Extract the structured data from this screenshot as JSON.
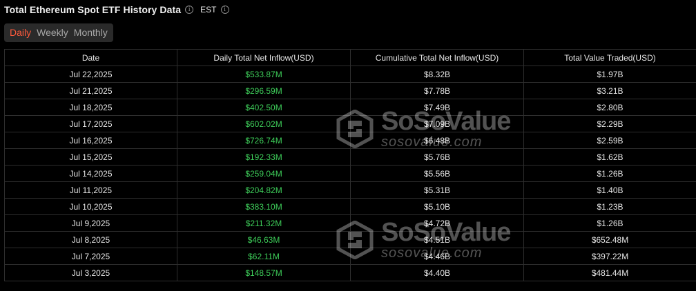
{
  "header": {
    "title": "Total Ethereum Spot ETF History Data",
    "timezone": "EST"
  },
  "tabs": [
    {
      "label": "Daily",
      "active": true
    },
    {
      "label": "Weekly",
      "active": false
    },
    {
      "label": "Monthly",
      "active": false
    }
  ],
  "table": {
    "columns": [
      "Date",
      "Daily Total Net Inflow(USD)",
      "Cumulative Total Net Inflow(USD)",
      "Total Value Traded(USD)"
    ],
    "rows": [
      {
        "date": "Jul 22,2025",
        "daily_inflow": "$533.87M",
        "cumulative": "$8.32B",
        "value_traded": "$1.97B"
      },
      {
        "date": "Jul 21,2025",
        "daily_inflow": "$296.59M",
        "cumulative": "$7.78B",
        "value_traded": "$3.21B"
      },
      {
        "date": "Jul 18,2025",
        "daily_inflow": "$402.50M",
        "cumulative": "$7.49B",
        "value_traded": "$2.80B"
      },
      {
        "date": "Jul 17,2025",
        "daily_inflow": "$602.02M",
        "cumulative": "$7.09B",
        "value_traded": "$2.29B"
      },
      {
        "date": "Jul 16,2025",
        "daily_inflow": "$726.74M",
        "cumulative": "$6.48B",
        "value_traded": "$2.59B"
      },
      {
        "date": "Jul 15,2025",
        "daily_inflow": "$192.33M",
        "cumulative": "$5.76B",
        "value_traded": "$1.62B"
      },
      {
        "date": "Jul 14,2025",
        "daily_inflow": "$259.04M",
        "cumulative": "$5.56B",
        "value_traded": "$1.26B"
      },
      {
        "date": "Jul 11,2025",
        "daily_inflow": "$204.82M",
        "cumulative": "$5.31B",
        "value_traded": "$1.40B"
      },
      {
        "date": "Jul 10,2025",
        "daily_inflow": "$383.10M",
        "cumulative": "$5.10B",
        "value_traded": "$1.23B"
      },
      {
        "date": "Jul 9,2025",
        "daily_inflow": "$211.32M",
        "cumulative": "$4.72B",
        "value_traded": "$1.26B"
      },
      {
        "date": "Jul 8,2025",
        "daily_inflow": "$46.63M",
        "cumulative": "$4.51B",
        "value_traded": "$652.48M"
      },
      {
        "date": "Jul 7,2025",
        "daily_inflow": "$62.11M",
        "cumulative": "$4.46B",
        "value_traded": "$397.22M"
      },
      {
        "date": "Jul 3,2025",
        "daily_inflow": "$148.57M",
        "cumulative": "$4.40B",
        "value_traded": "$481.44M"
      }
    ]
  },
  "watermark": {
    "brand": "SoSoValue",
    "url": "sosovalue.com"
  },
  "colors": {
    "background": "#000000",
    "active_tab": "#ff5a3c",
    "inflow_positive": "#3ecf5a",
    "grid": "#2e2e2e"
  }
}
